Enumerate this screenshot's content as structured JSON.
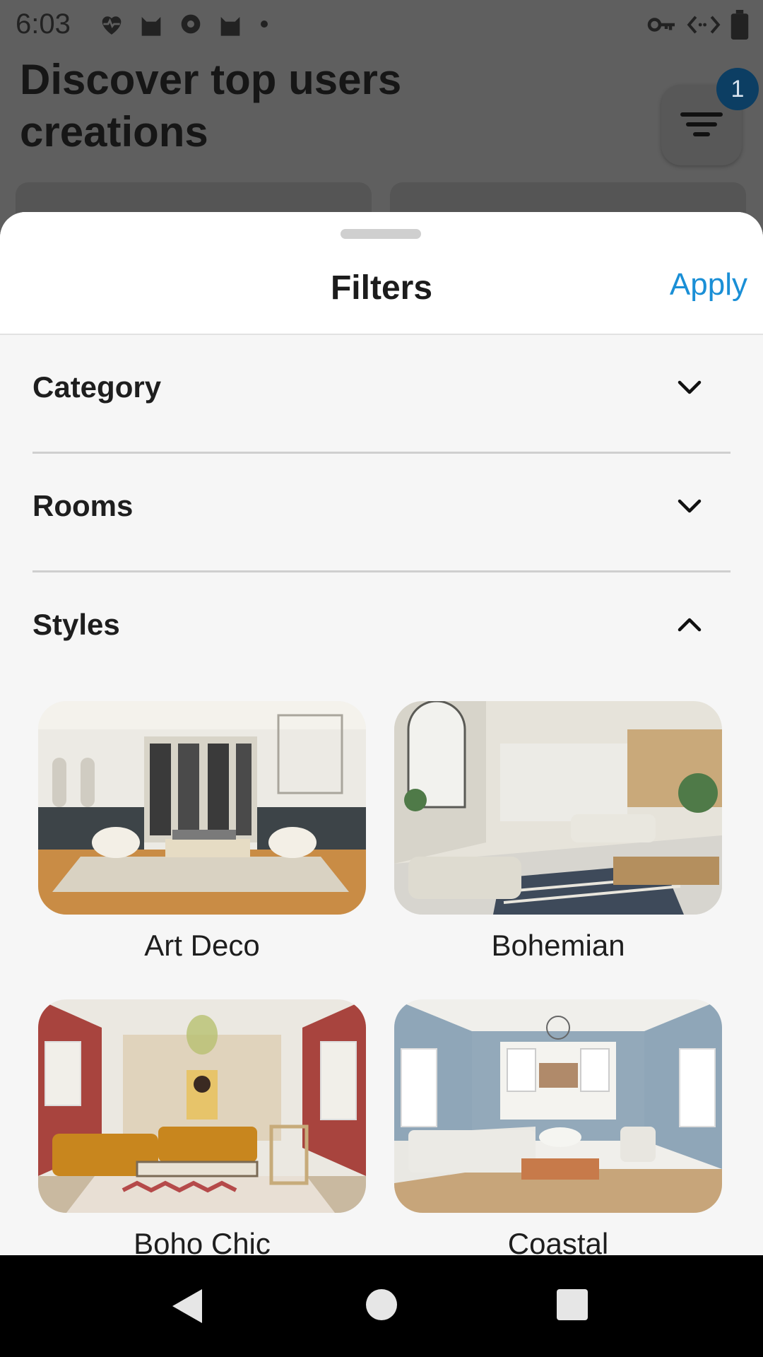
{
  "status_bar": {
    "time": "6:03",
    "left_icons": [
      "heart-pulse-icon",
      "cat-icon",
      "gear-blob-icon",
      "cat-icon",
      "dot-icon"
    ],
    "right_icons": [
      "key-icon",
      "code-arrows-icon",
      "battery-icon"
    ]
  },
  "background": {
    "title": "Discover top users creations",
    "filter_badge": "1"
  },
  "sheet": {
    "title": "Filters",
    "apply_label": "Apply",
    "sections": [
      {
        "label": "Category",
        "expanded": false
      },
      {
        "label": "Rooms",
        "expanded": false
      },
      {
        "label": "Styles",
        "expanded": true
      }
    ],
    "styles": [
      {
        "label": "Art Deco"
      },
      {
        "label": "Bohemian"
      },
      {
        "label": "Boho Chic"
      },
      {
        "label": "Coastal"
      }
    ]
  },
  "nav": {
    "icons": [
      "back-icon",
      "home-icon",
      "recents-icon"
    ]
  },
  "colors": {
    "accent": "#1a8fd6",
    "badge": "#0c3e63"
  }
}
